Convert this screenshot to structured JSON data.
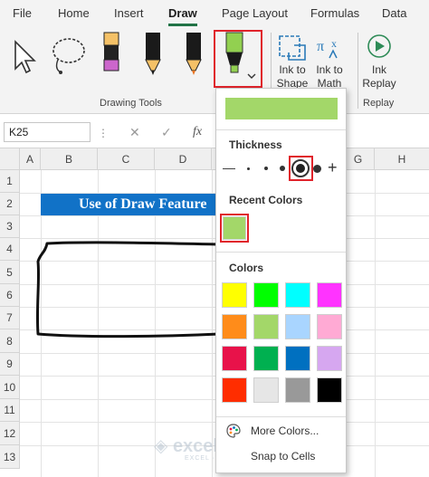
{
  "tabs": [
    "File",
    "Home",
    "Insert",
    "Draw",
    "Page Layout",
    "Formulas",
    "Data"
  ],
  "active_tab": "Draw",
  "ribbon": {
    "drawing_tools_label": "Drawing Tools",
    "replay_label": "Replay",
    "ink_to_shape_line1": "Ink to",
    "ink_to_shape_line2": "Shape",
    "ink_to_math_line1": "Ink to",
    "ink_to_math_line2": "Math",
    "ink_replay_line1": "Ink",
    "ink_replay_line2": "Replay",
    "pen_colors": [
      "#cc66cc",
      "#1a1a1a",
      "#e87322",
      "#92d050"
    ]
  },
  "formula_bar": {
    "name_box": "K25",
    "cancel_icon": "✕",
    "enter_icon": "✓",
    "function_icon": "fx"
  },
  "sheet": {
    "columns": [
      "A",
      "B",
      "C",
      "D",
      "G",
      "H"
    ],
    "rows": [
      "1",
      "2",
      "3",
      "4",
      "5",
      "6",
      "7",
      "8",
      "9",
      "10",
      "11",
      "12",
      "13"
    ],
    "title": "Use of Draw Feature"
  },
  "dropdown": {
    "current_color": "#a3d769",
    "thickness_label": "Thickness",
    "thickness_symbols": {
      "minus": "—",
      "plus": "+"
    },
    "recent_colors_label": "Recent Colors",
    "recent_colors": [
      "#a3d769"
    ],
    "colors_label": "Colors",
    "colors": [
      [
        "#ffff00",
        "#00ff00",
        "#00ffff",
        "#ff33ff"
      ],
      [
        "#ff8c1a",
        "#a3d769",
        "#a9d5ff",
        "#ffaad4"
      ],
      [
        "#e8124a",
        "#00b050",
        "#0070c0",
        "#d6a7f0"
      ],
      [
        "#ff2d00",
        "#e6e6e6",
        "#999999",
        "#000000"
      ]
    ],
    "more_colors": "More Colors...",
    "snap_to_cells": "Snap to Cells"
  },
  "watermark": {
    "brand": "exceldemy",
    "tagline": "EXCEL · DATA · BI"
  }
}
